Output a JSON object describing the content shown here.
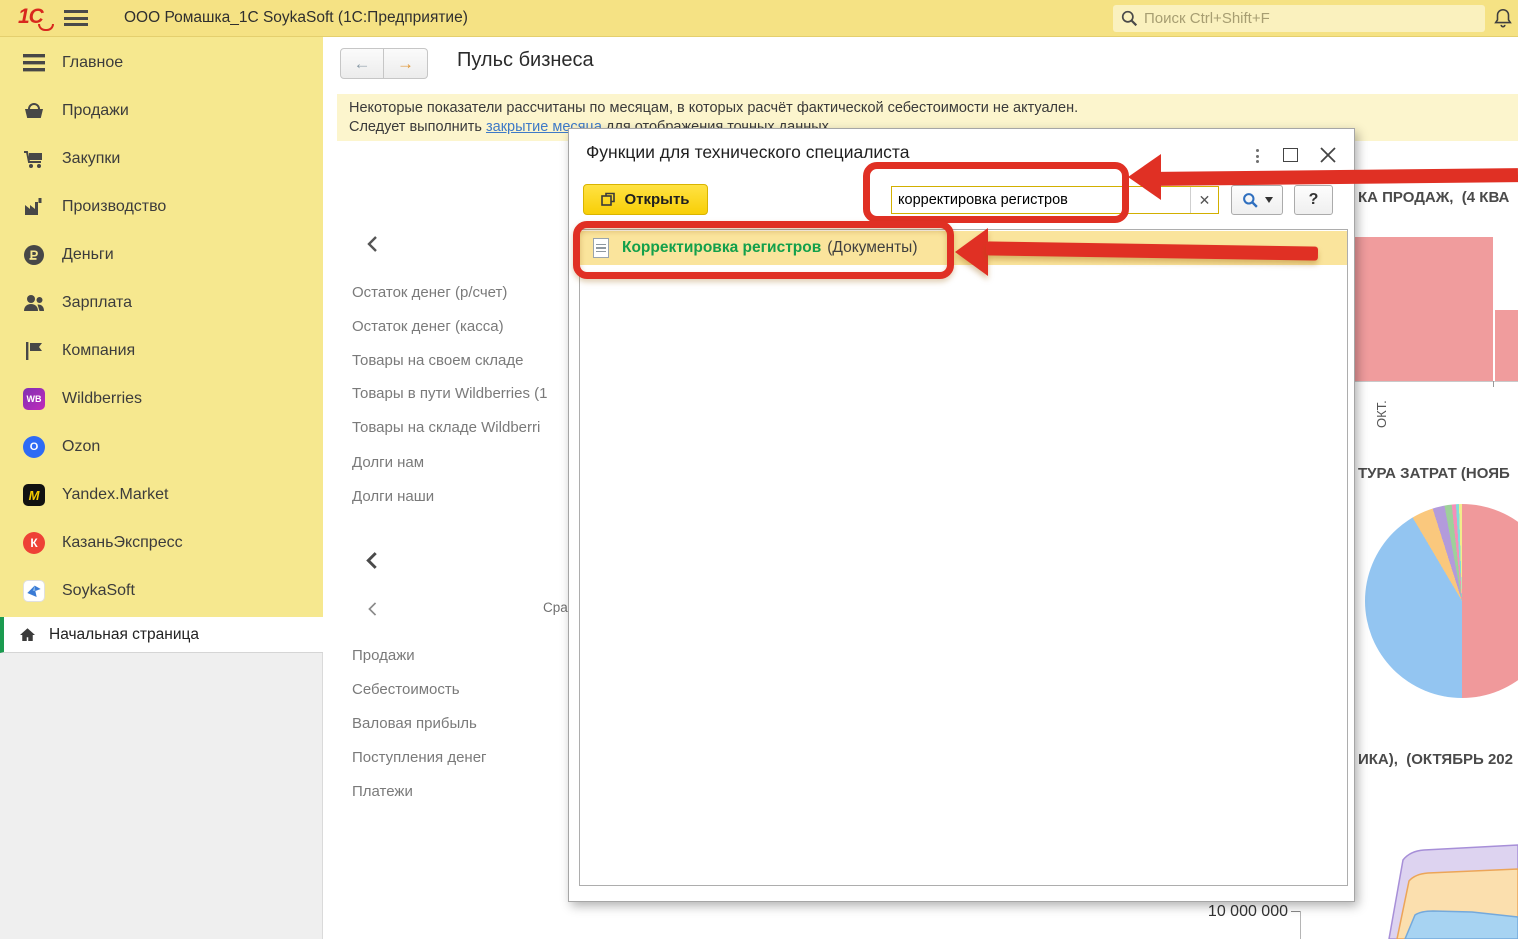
{
  "topbar": {
    "logo": "1С",
    "title": "ООО Ромашка_1С SoykaSoft  (1С:Предприятие)",
    "search_placeholder": "Поиск Ctrl+Shift+F"
  },
  "sidebar": {
    "items": [
      {
        "label": "Главное"
      },
      {
        "label": "Продажи"
      },
      {
        "label": "Закупки"
      },
      {
        "label": "Производство"
      },
      {
        "label": "Деньги"
      },
      {
        "label": "Зарплата"
      },
      {
        "label": "Компания"
      },
      {
        "label": "Wildberries",
        "badge": "WB"
      },
      {
        "label": "Ozon",
        "badge": "O"
      },
      {
        "label": "Yandex.Market",
        "badge": "M"
      },
      {
        "label": "КазаньЭкспресс",
        "badge": "К"
      },
      {
        "label": "SoykaSoft"
      }
    ],
    "home": "Начальная страница"
  },
  "page": {
    "title": "Пульс бизнеса",
    "warning_line1": "Некоторые показатели рассчитаны по месяцам, в которых расчёт фактической себестоимости не актуален.",
    "warning_line2_prefix": "Следует выполнить ",
    "warning_link": "закрытие месяца",
    "warning_line2_suffix": " для отображения точных данных.",
    "list1": [
      "Остаток денег (р/счет)",
      "Остаток денег (касса)",
      "Товары на своем складе",
      "Товары в пути Wildberries (1",
      "Товары на складе Wildberri",
      "Долги нам",
      "Долги наши"
    ],
    "compare_clipped": "Сра",
    "list2": [
      "Продажи",
      "Себестоимость",
      "Валовая прибыль",
      "Поступления денег",
      "Платежи"
    ]
  },
  "modal": {
    "title": "Функции для технического специалиста",
    "open_button": "Открыть",
    "search_value": "корректировка регистров",
    "clear_label": "✕",
    "help_button": "?",
    "result_name": "Корректировка регистров",
    "result_type": "(Документы)"
  },
  "charts": {
    "sales_title_clipped": "КА ПРОДАЖ,  (4 КВА",
    "sales_axis_label": "ОКТ.",
    "bar_color": "#F09C9D",
    "costs_title_clipped": "ТУРА ЗАТРАТ (НОЯБ",
    "pie_slices": [
      {
        "color": "#F0999B",
        "pct": 50.0
      },
      {
        "color": "#93C5F1",
        "pct": 41.5
      },
      {
        "color": "#FAC87D",
        "pct": 3.6
      },
      {
        "color": "#B39BDB",
        "pct": 2.0
      },
      {
        "color": "#9ED09A",
        "pct": 1.2
      },
      {
        "color": "#F48FB9",
        "pct": 0.7
      },
      {
        "color": "#82DBDB",
        "pct": 0.5
      },
      {
        "color": "#F2EC8A",
        "pct": 0.5
      }
    ],
    "dynamics_title_clipped": "ИКА),  (ОКТЯБРЬ 202",
    "y_axis_label": "10 000 000",
    "area_colors": {
      "top": "#DDD3F0",
      "middle": "#FBDFAE",
      "bottom": "#A7D3F2"
    }
  },
  "colors": {
    "topbar_bg": "#F5E284",
    "sidebar_bg": "#F6E88F",
    "warning_bg": "#FCF5CD",
    "result_row_bg": "#FAE49C",
    "annotation_red": "#E03024",
    "result_green": "#13A04B",
    "open_button_yellow": "#F8CF07",
    "home_accent_green": "#1B9B50"
  }
}
